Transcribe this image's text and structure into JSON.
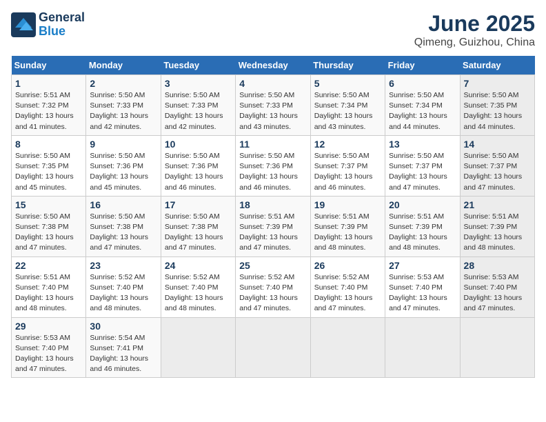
{
  "header": {
    "logo_line1": "General",
    "logo_line2": "Blue",
    "title": "June 2025",
    "subtitle": "Qimeng, Guizhou, China"
  },
  "weekdays": [
    "Sunday",
    "Monday",
    "Tuesday",
    "Wednesday",
    "Thursday",
    "Friday",
    "Saturday"
  ],
  "weeks": [
    [
      {
        "day": "1",
        "info": "Sunrise: 5:51 AM\nSunset: 7:32 PM\nDaylight: 13 hours\nand 41 minutes."
      },
      {
        "day": "2",
        "info": "Sunrise: 5:50 AM\nSunset: 7:33 PM\nDaylight: 13 hours\nand 42 minutes."
      },
      {
        "day": "3",
        "info": "Sunrise: 5:50 AM\nSunset: 7:33 PM\nDaylight: 13 hours\nand 42 minutes."
      },
      {
        "day": "4",
        "info": "Sunrise: 5:50 AM\nSunset: 7:33 PM\nDaylight: 13 hours\nand 43 minutes."
      },
      {
        "day": "5",
        "info": "Sunrise: 5:50 AM\nSunset: 7:34 PM\nDaylight: 13 hours\nand 43 minutes."
      },
      {
        "day": "6",
        "info": "Sunrise: 5:50 AM\nSunset: 7:34 PM\nDaylight: 13 hours\nand 44 minutes."
      },
      {
        "day": "7",
        "info": "Sunrise: 5:50 AM\nSunset: 7:35 PM\nDaylight: 13 hours\nand 44 minutes."
      }
    ],
    [
      {
        "day": "8",
        "info": "Sunrise: 5:50 AM\nSunset: 7:35 PM\nDaylight: 13 hours\nand 45 minutes."
      },
      {
        "day": "9",
        "info": "Sunrise: 5:50 AM\nSunset: 7:36 PM\nDaylight: 13 hours\nand 45 minutes."
      },
      {
        "day": "10",
        "info": "Sunrise: 5:50 AM\nSunset: 7:36 PM\nDaylight: 13 hours\nand 46 minutes."
      },
      {
        "day": "11",
        "info": "Sunrise: 5:50 AM\nSunset: 7:36 PM\nDaylight: 13 hours\nand 46 minutes."
      },
      {
        "day": "12",
        "info": "Sunrise: 5:50 AM\nSunset: 7:37 PM\nDaylight: 13 hours\nand 46 minutes."
      },
      {
        "day": "13",
        "info": "Sunrise: 5:50 AM\nSunset: 7:37 PM\nDaylight: 13 hours\nand 47 minutes."
      },
      {
        "day": "14",
        "info": "Sunrise: 5:50 AM\nSunset: 7:37 PM\nDaylight: 13 hours\nand 47 minutes."
      }
    ],
    [
      {
        "day": "15",
        "info": "Sunrise: 5:50 AM\nSunset: 7:38 PM\nDaylight: 13 hours\nand 47 minutes."
      },
      {
        "day": "16",
        "info": "Sunrise: 5:50 AM\nSunset: 7:38 PM\nDaylight: 13 hours\nand 47 minutes."
      },
      {
        "day": "17",
        "info": "Sunrise: 5:50 AM\nSunset: 7:38 PM\nDaylight: 13 hours\nand 47 minutes."
      },
      {
        "day": "18",
        "info": "Sunrise: 5:51 AM\nSunset: 7:39 PM\nDaylight: 13 hours\nand 47 minutes."
      },
      {
        "day": "19",
        "info": "Sunrise: 5:51 AM\nSunset: 7:39 PM\nDaylight: 13 hours\nand 48 minutes."
      },
      {
        "day": "20",
        "info": "Sunrise: 5:51 AM\nSunset: 7:39 PM\nDaylight: 13 hours\nand 48 minutes."
      },
      {
        "day": "21",
        "info": "Sunrise: 5:51 AM\nSunset: 7:39 PM\nDaylight: 13 hours\nand 48 minutes."
      }
    ],
    [
      {
        "day": "22",
        "info": "Sunrise: 5:51 AM\nSunset: 7:40 PM\nDaylight: 13 hours\nand 48 minutes."
      },
      {
        "day": "23",
        "info": "Sunrise: 5:52 AM\nSunset: 7:40 PM\nDaylight: 13 hours\nand 48 minutes."
      },
      {
        "day": "24",
        "info": "Sunrise: 5:52 AM\nSunset: 7:40 PM\nDaylight: 13 hours\nand 48 minutes."
      },
      {
        "day": "25",
        "info": "Sunrise: 5:52 AM\nSunset: 7:40 PM\nDaylight: 13 hours\nand 47 minutes."
      },
      {
        "day": "26",
        "info": "Sunrise: 5:52 AM\nSunset: 7:40 PM\nDaylight: 13 hours\nand 47 minutes."
      },
      {
        "day": "27",
        "info": "Sunrise: 5:53 AM\nSunset: 7:40 PM\nDaylight: 13 hours\nand 47 minutes."
      },
      {
        "day": "28",
        "info": "Sunrise: 5:53 AM\nSunset: 7:40 PM\nDaylight: 13 hours\nand 47 minutes."
      }
    ],
    [
      {
        "day": "29",
        "info": "Sunrise: 5:53 AM\nSunset: 7:40 PM\nDaylight: 13 hours\nand 47 minutes."
      },
      {
        "day": "30",
        "info": "Sunrise: 5:54 AM\nSunset: 7:41 PM\nDaylight: 13 hours\nand 46 minutes."
      },
      {
        "day": "",
        "info": ""
      },
      {
        "day": "",
        "info": ""
      },
      {
        "day": "",
        "info": ""
      },
      {
        "day": "",
        "info": ""
      },
      {
        "day": "",
        "info": ""
      }
    ]
  ]
}
